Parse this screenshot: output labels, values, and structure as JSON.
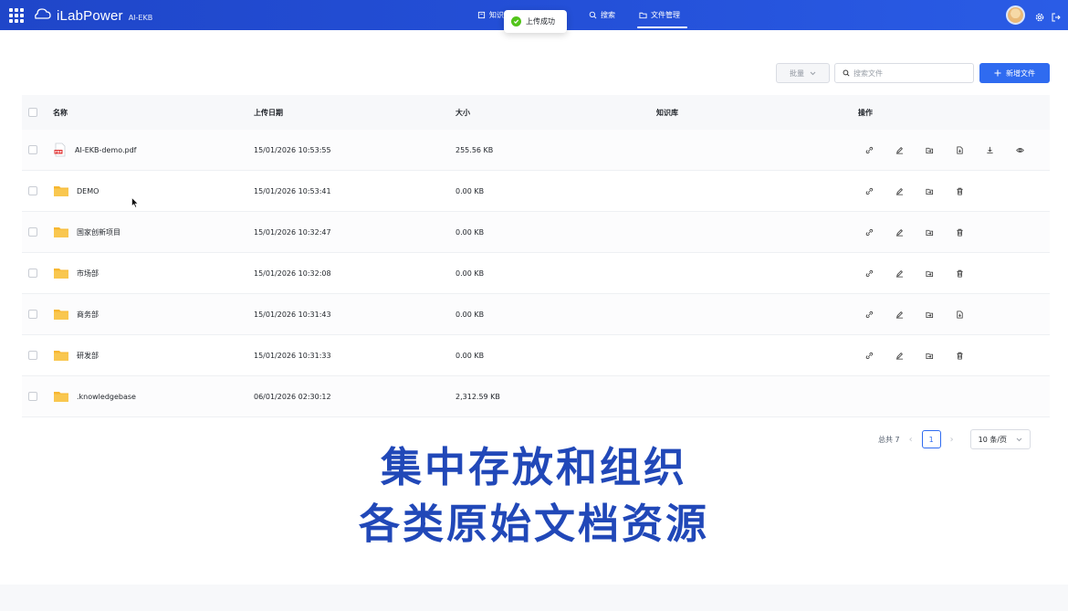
{
  "header": {
    "brand_name": "iLabPower",
    "brand_sub": "AI-EKB",
    "nav": [
      {
        "label": "知识",
        "icon": "book-icon"
      },
      {
        "label": "搜索",
        "icon": "search-icon"
      },
      {
        "label": "文件管理",
        "icon": "folder-icon",
        "active": true
      }
    ],
    "toast": "上传成功"
  },
  "toolbar": {
    "batch_label": "批量",
    "search_placeholder": "搜索文件",
    "new_label": "新增文件"
  },
  "table": {
    "columns": [
      "名称",
      "上传日期",
      "大小",
      "知识库",
      "操作"
    ],
    "rows": [
      {
        "name": "AI-EKB-demo.pdf",
        "type": "pdf",
        "date": "15/01/2026 10:53:55",
        "size": "255.56 KB",
        "kb": ""
      },
      {
        "name": "DEMO",
        "type": "folder",
        "date": "15/01/2026 10:53:41",
        "size": "0.00 KB",
        "kb": ""
      },
      {
        "name": "国家创新项目",
        "type": "folder",
        "date": "15/01/2026 10:32:47",
        "size": "0.00 KB",
        "kb": ""
      },
      {
        "name": "市场部",
        "type": "folder",
        "date": "15/01/2026 10:32:08",
        "size": "0.00 KB",
        "kb": ""
      },
      {
        "name": "商务部",
        "type": "folder",
        "date": "15/01/2026 10:31:43",
        "size": "0.00 KB",
        "kb": ""
      },
      {
        "name": "研发部",
        "type": "folder",
        "date": "15/01/2026 10:31:33",
        "size": "0.00 KB",
        "kb": ""
      },
      {
        "name": ".knowledgebase",
        "type": "folder",
        "date": "06/01/2026 02:30:12",
        "size": "2,312.59 KB",
        "kb": ""
      }
    ]
  },
  "pagination": {
    "total_label": "总共 7",
    "current_page": "1",
    "page_size": "10 条/页"
  },
  "caption": {
    "line1": "集中存放和组织",
    "line2": "各类原始文档资源"
  },
  "colors": {
    "header_bg": "#2450d8",
    "primary": "#2f6bf0",
    "caption": "#2148b8",
    "success": "#52c41a",
    "folder": "#f7b731"
  }
}
